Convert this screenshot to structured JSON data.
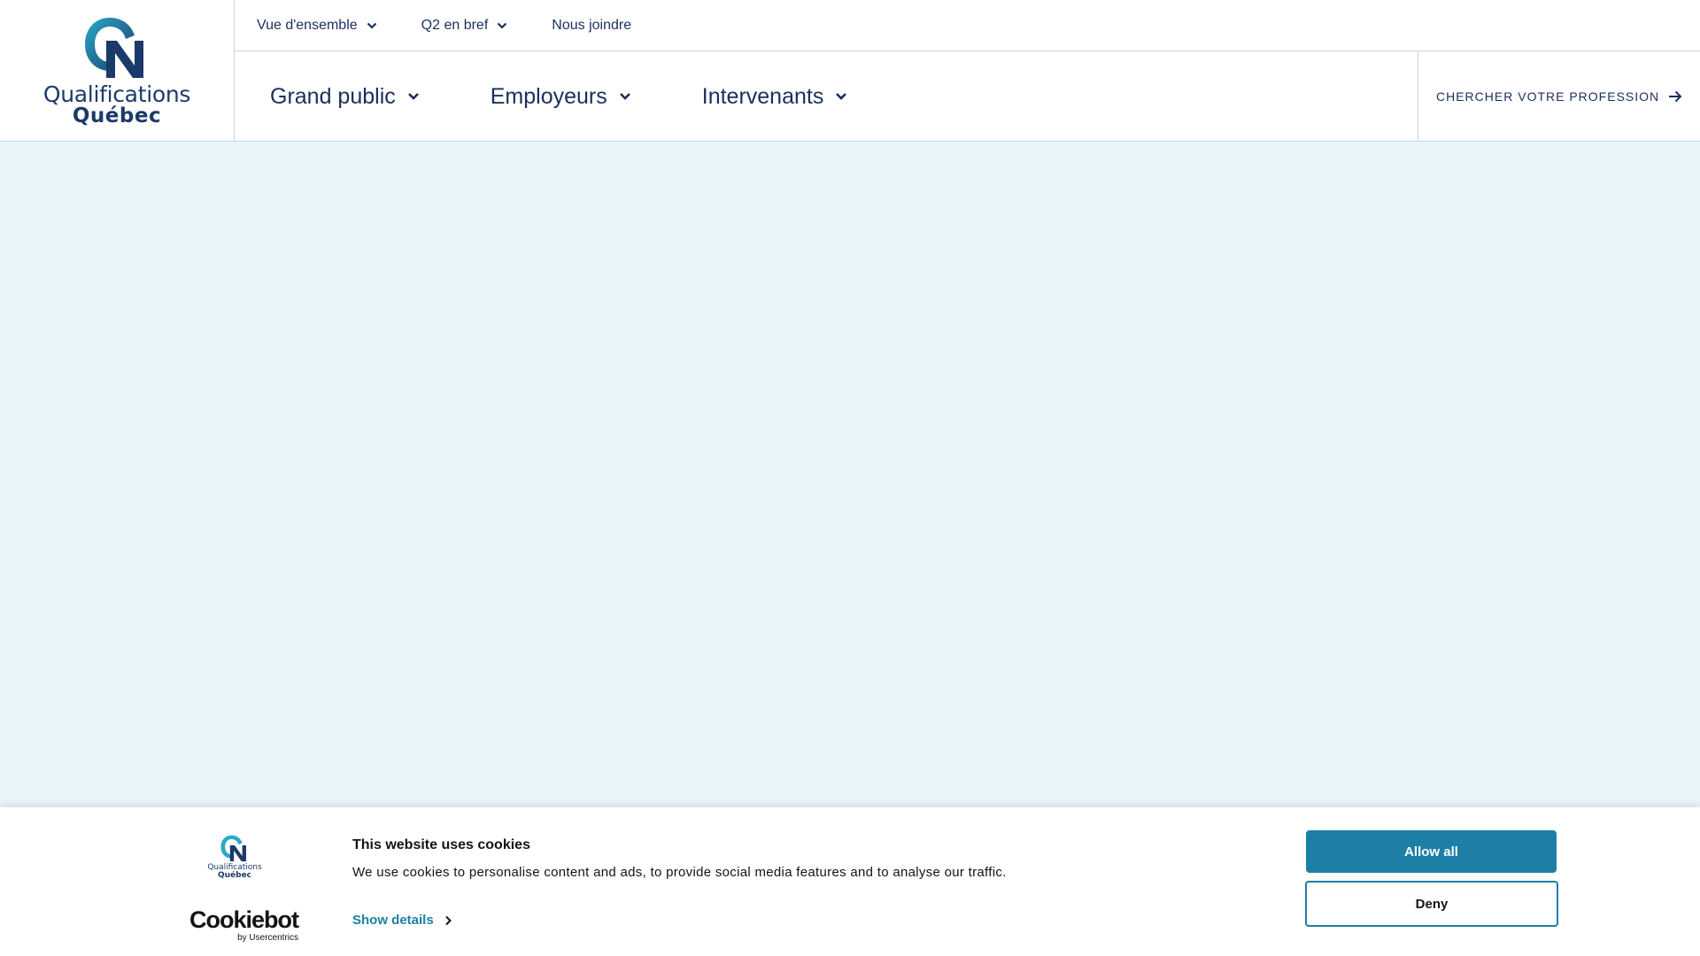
{
  "brand": {
    "name_line1": "Qualifications",
    "name_line2": "Québec",
    "colors": {
      "navy": "#1b3a6b",
      "teal": "#2a9dbf",
      "hero_bg": "#e8f6fb",
      "accent": "#1d7fa6"
    }
  },
  "top_nav": {
    "items": [
      {
        "label": "Vue d'ensemble",
        "has_dropdown": true
      },
      {
        "label": "Q2 en bref",
        "has_dropdown": true
      },
      {
        "label": "Nous joindre",
        "has_dropdown": false
      }
    ]
  },
  "main_nav": {
    "items": [
      {
        "label": "Grand public",
        "has_dropdown": true
      },
      {
        "label": "Employeurs",
        "has_dropdown": true
      },
      {
        "label": "Intervenants",
        "has_dropdown": true
      }
    ],
    "search_cta": "CHERCHER VOTRE PROFESSION"
  },
  "cookie_banner": {
    "title": "This website uses cookies",
    "text": "We use cookies to personalise content and ads, to provide social media features and to analyse our traffic.",
    "show_details": "Show details",
    "allow_all": "Allow all",
    "deny": "Deny",
    "provider": "Cookiebot",
    "provider_sub": "by Usercentrics",
    "logo_line1": "Qualifications",
    "logo_line2": "Québec"
  }
}
